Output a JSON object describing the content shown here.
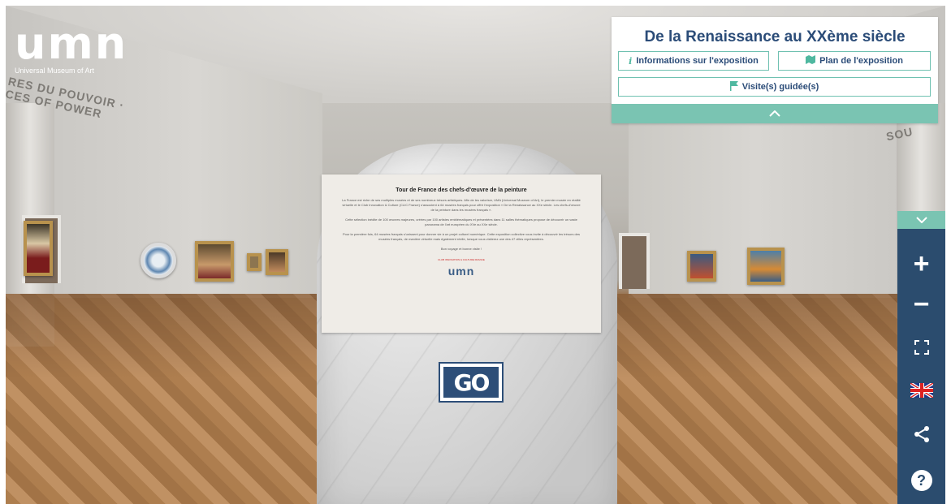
{
  "brand": {
    "logo_text": "umn",
    "subtitle": "Universal Museum of Art"
  },
  "exhibition": {
    "title": "De la Renaissance au XXème siècle",
    "buttons": {
      "info": "Informations sur l'exposition",
      "plan": "Plan de l'exposition",
      "guided_tour": "Visite(s) guidée(s)"
    },
    "icons": {
      "info": "info-icon",
      "plan": "map-icon",
      "guided_tour": "flag-icon",
      "collapse": "chevron-up-icon"
    }
  },
  "scene_signs": {
    "left": "RES DU POUVOIR · CES OF POWER",
    "right": "SOU"
  },
  "info_card": {
    "title": "Tour de France des chefs-d'œuvre de la peinture",
    "paragraphs": [
      "La France est riche de ses multiples musées et de ses nombreux trésors artistiques. Afin de les valoriser, UMA (Universal Museum of Art), le premier musée en réalité virtuelle et le Club Innovation & Culture (CLIC France) s'associent à 64 musées français pour offrir l'exposition « De la Renaissance au XXe siècle. Les chefs-d'œuvre de la peinture dans les musées français ».",
      "Cette sélection inédite de 100 œuvres majeures, créées par 100 artistes emblématiques et présentées dans 11 salles thématiques propose de découvrir un vaste panorama de l'art européen du XVe au XXe siècle.",
      "Pour la première fois, 64 musées français s'unissent pour donner vie à un projet culturel numérique. Cette exposition collective vous invite à découvrir les trésors des musées français, de manière virtuelle mais également réelle, lorsque vous visiterez une des 47 villes représentées.",
      "Bon voyage et bonne visite !"
    ],
    "partner": "CLUB INNOVATION & CULTURE FRANCE",
    "logo": "umn"
  },
  "go_button": {
    "label": "GO"
  },
  "toolbar": {
    "collapse_icon": "chevron-down-icon",
    "zoom_in": "+",
    "zoom_out": "−",
    "fullscreen_icon": "fullscreen-icon",
    "language_icon": "uk-flag-icon",
    "share_icon": "share-icon",
    "help": "?"
  },
  "colors": {
    "navy": "#2b4c78",
    "teal": "#7ac4b2",
    "toolbar_bg": "#2b4c6e"
  }
}
